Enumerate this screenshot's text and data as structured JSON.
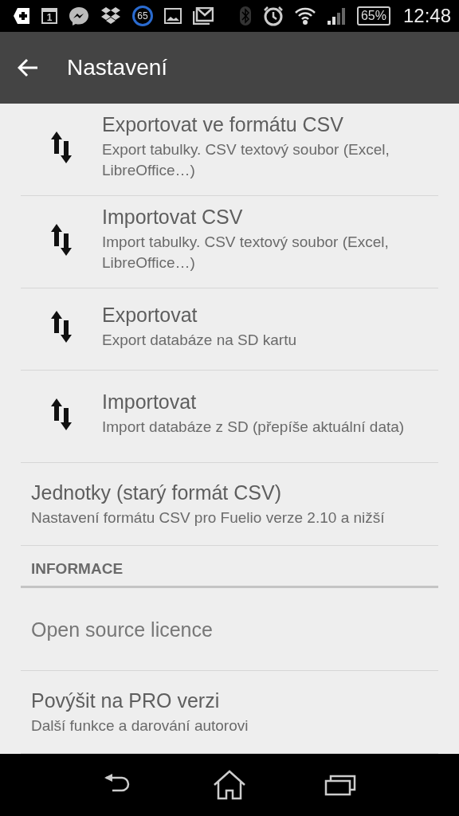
{
  "status_bar": {
    "calendar_day": "1",
    "badge_count": "65",
    "battery": "65%",
    "time": "12:48"
  },
  "toolbar": {
    "title": "Nastavení"
  },
  "items": [
    {
      "kind": "icon",
      "title": "Exportovat ve formátu CSV",
      "subtitle": "Export tabulky. CSV textový soubor (Excel, LibreOffice…)"
    },
    {
      "kind": "icon",
      "title": "Importovat CSV",
      "subtitle": "Import tabulky. CSV textový soubor (Excel, LibreOffice…)"
    },
    {
      "kind": "icon",
      "title": "Exportovat",
      "subtitle": "Export databáze na SD kartu"
    },
    {
      "kind": "icon",
      "title": "Importovat",
      "subtitle": "Import databáze z SD (přepíše aktuální data)"
    },
    {
      "kind": "plain",
      "title": "Jednotky (starý formát CSV)",
      "subtitle": "Nastavení formátu CSV pro Fuelio verze 2.10 a nižší"
    },
    {
      "kind": "header",
      "title": "INFORMACE"
    },
    {
      "kind": "plain",
      "title": "Open source licence"
    },
    {
      "kind": "plain",
      "title": "Povýšit na PRO verzi",
      "subtitle": "Další funkce a darování autorovi"
    }
  ]
}
